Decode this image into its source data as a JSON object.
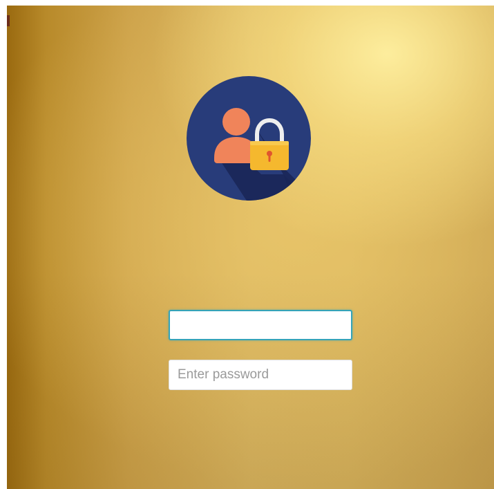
{
  "login": {
    "avatar_icon": "user-lock-icon",
    "username": {
      "value": "",
      "placeholder": ""
    },
    "password": {
      "value": "",
      "placeholder": "Enter password"
    }
  },
  "colors": {
    "background_gold": "#d9b560",
    "avatar_circle": "#283c7a",
    "avatar_shadow": "#1a2658",
    "user_figure": "#f0845a",
    "lock_body": "#f5b82e",
    "lock_shackle": "#eeeeee",
    "focus_border": "#35a3b8"
  }
}
